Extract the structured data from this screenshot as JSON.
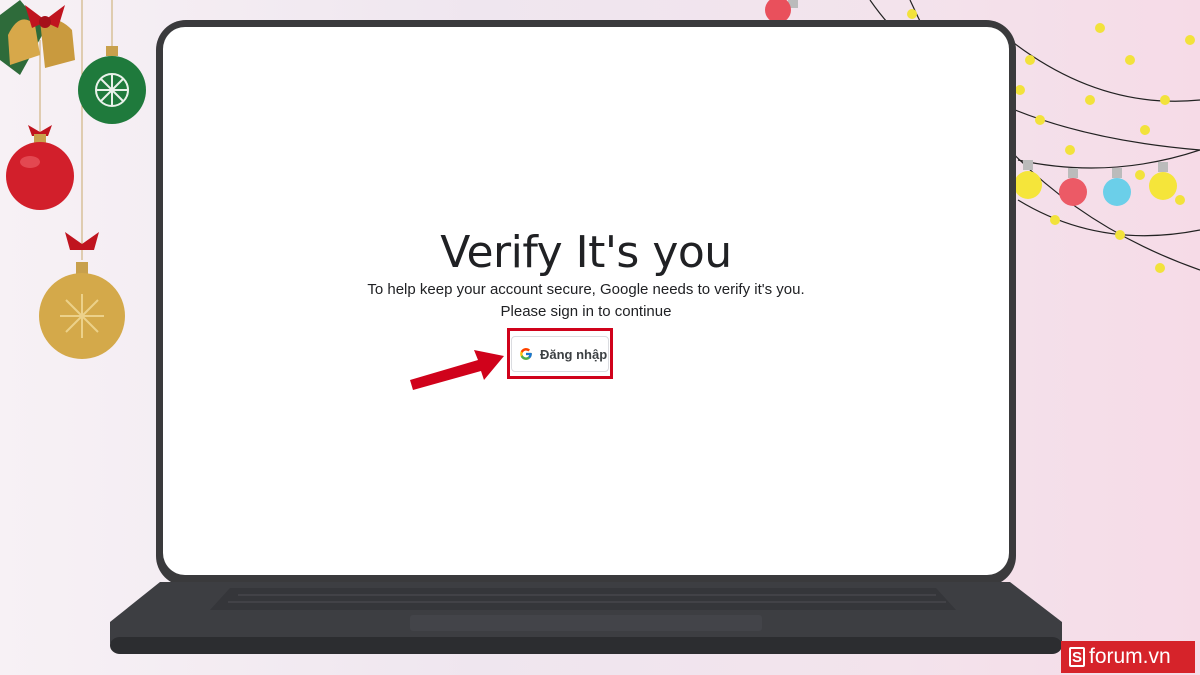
{
  "screen": {
    "title": "Verify It's you",
    "description_line1": "To help keep your account secure, Google needs to verify it's you.",
    "description_line2": "Please sign in to continue",
    "signin_button_label": "Đăng nhập",
    "signin_icon": "google-g-icon"
  },
  "annotation": {
    "arrow_icon": "red-arrow-icon",
    "highlight_color": "#d0021b"
  },
  "watermark": {
    "logo_letter": "S",
    "site": "forum.vn",
    "color": "#d6232a"
  },
  "decorations": [
    "bell-ornament",
    "green-bauble",
    "red-bauble",
    "gold-bauble",
    "string-lights"
  ]
}
